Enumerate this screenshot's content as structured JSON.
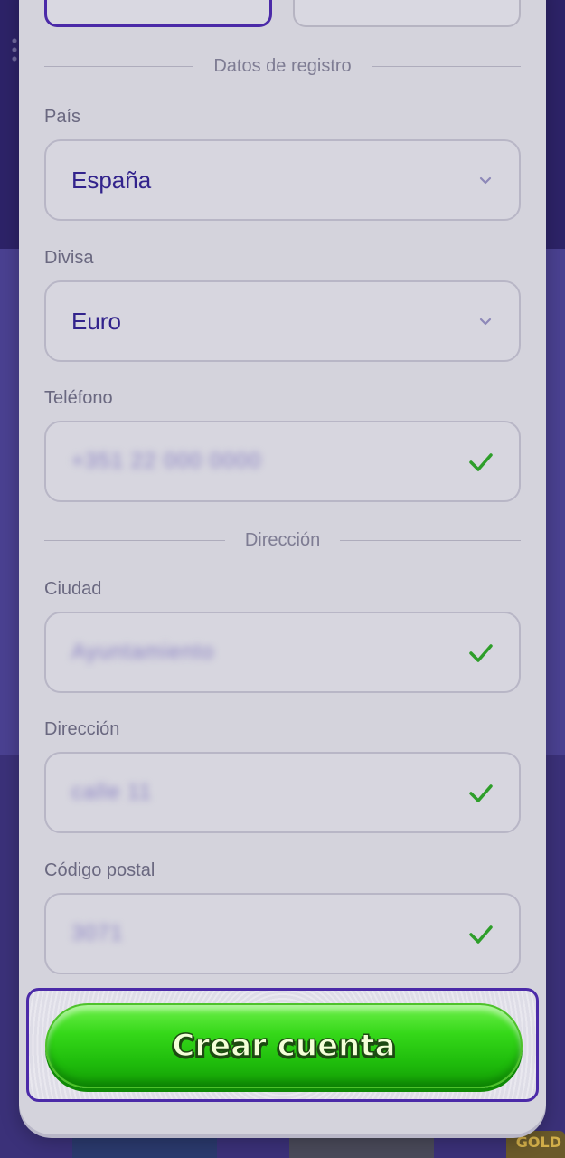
{
  "sections": {
    "registration": "Datos de registro",
    "address": "Dirección"
  },
  "fields": {
    "country": {
      "label": "País",
      "value": "España"
    },
    "currency": {
      "label": "Divisa",
      "value": "Euro"
    },
    "phone": {
      "label": "Teléfono",
      "value": "+351 22 000 0000"
    },
    "city": {
      "label": "Ciudad",
      "value": "Ayuntamiento"
    },
    "address": {
      "label": "Dirección",
      "value": "calle 11"
    },
    "postal": {
      "label": "Código postal",
      "value": "3071"
    }
  },
  "cta": {
    "label": "Crear cuenta"
  },
  "background": {
    "card_text": "GOLD"
  },
  "colors": {
    "accent": "#4b2aa8",
    "valid": "#2e9e2a",
    "cta": "#2ed116"
  }
}
